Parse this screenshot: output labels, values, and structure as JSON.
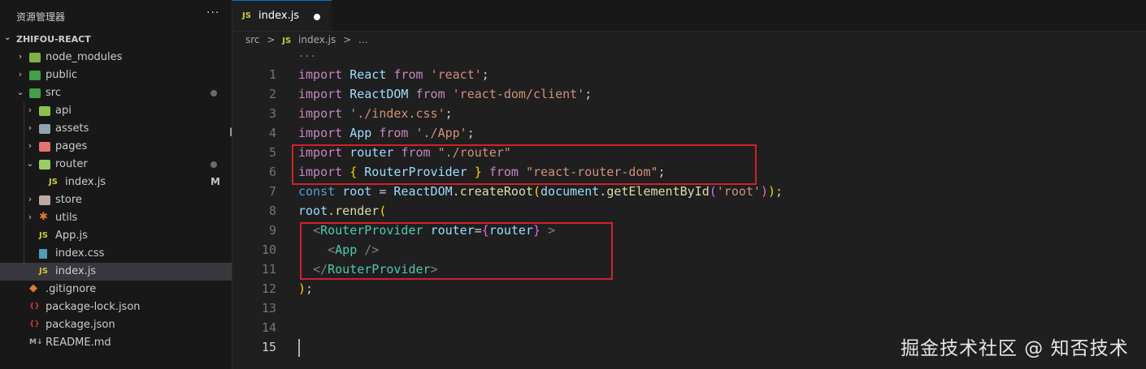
{
  "explorer": {
    "title": "资源管理器",
    "more": "···",
    "root": "ZHIFOU-REACT",
    "items": [
      {
        "label": "node_modules",
        "kind": "folder"
      },
      {
        "label": "public",
        "kind": "folder"
      },
      {
        "label": "src",
        "kind": "folder"
      },
      {
        "label": "api",
        "kind": "folder"
      },
      {
        "label": "assets",
        "kind": "folder"
      },
      {
        "label": "pages",
        "kind": "folder"
      },
      {
        "label": "router",
        "kind": "folder"
      },
      {
        "label": "index.js",
        "kind": "js",
        "badge": "M"
      },
      {
        "label": "store",
        "kind": "folder"
      },
      {
        "label": "utils",
        "kind": "folder"
      },
      {
        "label": "App.js",
        "kind": "js"
      },
      {
        "label": "index.css",
        "kind": "css"
      },
      {
        "label": "index.js",
        "kind": "js"
      },
      {
        "label": ".gitignore",
        "kind": "git"
      },
      {
        "label": "package-lock.json",
        "kind": "json"
      },
      {
        "label": "package.json",
        "kind": "json"
      },
      {
        "label": "README.md",
        "kind": "md"
      }
    ]
  },
  "editor": {
    "tab": {
      "icon": "JS",
      "name": "index.js"
    },
    "breadcrumb": {
      "folder": "src",
      "sep": ">",
      "icon": "JS",
      "file": "index.js",
      "sep2": ">",
      "more": "..."
    },
    "fold_hint": "...",
    "line_numbers": [
      "1",
      "2",
      "3",
      "4",
      "5",
      "6",
      "7",
      "8",
      "9",
      "10",
      "11",
      "12",
      "13",
      "14",
      "15"
    ],
    "lines": [
      [
        [
          "import",
          "kw"
        ],
        [
          " ",
          ""
        ],
        [
          "React",
          "id"
        ],
        [
          " ",
          ""
        ],
        [
          "from",
          "kw"
        ],
        [
          " ",
          ""
        ],
        [
          "'react'",
          "str"
        ],
        [
          ";",
          "pun"
        ]
      ],
      [
        [
          "import",
          "kw"
        ],
        [
          " ",
          ""
        ],
        [
          "ReactDOM",
          "id"
        ],
        [
          " ",
          ""
        ],
        [
          "from",
          "kw"
        ],
        [
          " ",
          ""
        ],
        [
          "'react-dom/client'",
          "str"
        ],
        [
          ";",
          "pun"
        ]
      ],
      [
        [
          "import",
          "kw"
        ],
        [
          " ",
          ""
        ],
        [
          "'./index.css'",
          "str"
        ],
        [
          ";",
          "pun"
        ]
      ],
      [
        [
          "import",
          "kw"
        ],
        [
          " ",
          ""
        ],
        [
          "App",
          "id"
        ],
        [
          " ",
          ""
        ],
        [
          "from",
          "kw"
        ],
        [
          " ",
          ""
        ],
        [
          "'./App'",
          "str"
        ],
        [
          ";",
          "pun"
        ]
      ],
      [
        [
          "import",
          "kw"
        ],
        [
          " ",
          ""
        ],
        [
          "router",
          "id"
        ],
        [
          " ",
          ""
        ],
        [
          "from",
          "kw"
        ],
        [
          " ",
          ""
        ],
        [
          "\"./router\"",
          "str"
        ]
      ],
      [
        [
          "import",
          "kw"
        ],
        [
          " ",
          ""
        ],
        [
          "{",
          "br1"
        ],
        [
          " ",
          ""
        ],
        [
          "RouterProvider",
          "id"
        ],
        [
          " ",
          ""
        ],
        [
          "}",
          "br1"
        ],
        [
          " ",
          ""
        ],
        [
          "from",
          "kw"
        ],
        [
          " ",
          ""
        ],
        [
          "\"react-router-dom\"",
          "str"
        ],
        [
          ";",
          "pun"
        ]
      ],
      [
        [
          "const",
          "kw2"
        ],
        [
          " ",
          ""
        ],
        [
          "root",
          "id"
        ],
        [
          " = ",
          "pun"
        ],
        [
          "ReactDOM",
          "id"
        ],
        [
          ".",
          "pun"
        ],
        [
          "createRoot",
          "fn"
        ],
        [
          "(",
          "br1"
        ],
        [
          "document",
          "id"
        ],
        [
          ".",
          "pun"
        ],
        [
          "getElementById",
          "fn"
        ],
        [
          "(",
          "br2"
        ],
        [
          "'root'",
          "str"
        ],
        [
          ")",
          "br2"
        ],
        [
          ")",
          "br1"
        ],
        [
          ";",
          "pun"
        ]
      ],
      [
        [
          "root",
          "id"
        ],
        [
          ".",
          "pun"
        ],
        [
          "render",
          "fn"
        ],
        [
          "(",
          "br1"
        ]
      ],
      [
        [
          "  ",
          ""
        ],
        [
          "<",
          "tag"
        ],
        [
          "RouterProvider",
          "tagn"
        ],
        [
          " ",
          ""
        ],
        [
          "router",
          "id"
        ],
        [
          "=",
          "pun"
        ],
        [
          "{",
          "br2"
        ],
        [
          "router",
          "id"
        ],
        [
          "}",
          "br2"
        ],
        [
          " ",
          ""
        ],
        [
          ">",
          "tag"
        ]
      ],
      [
        [
          "    ",
          ""
        ],
        [
          "<",
          "tag"
        ],
        [
          "App",
          "tagn"
        ],
        [
          " ",
          ""
        ],
        [
          "/>",
          "tag"
        ]
      ],
      [
        [
          "  ",
          ""
        ],
        [
          "</",
          "tag"
        ],
        [
          "RouterProvider",
          "tagn"
        ],
        [
          ">",
          "tag"
        ]
      ],
      [
        [
          ")",
          "br1"
        ],
        [
          ";",
          "pun"
        ]
      ],
      [],
      [],
      []
    ]
  },
  "watermark": "掘金技术社区 @ 知否技术"
}
